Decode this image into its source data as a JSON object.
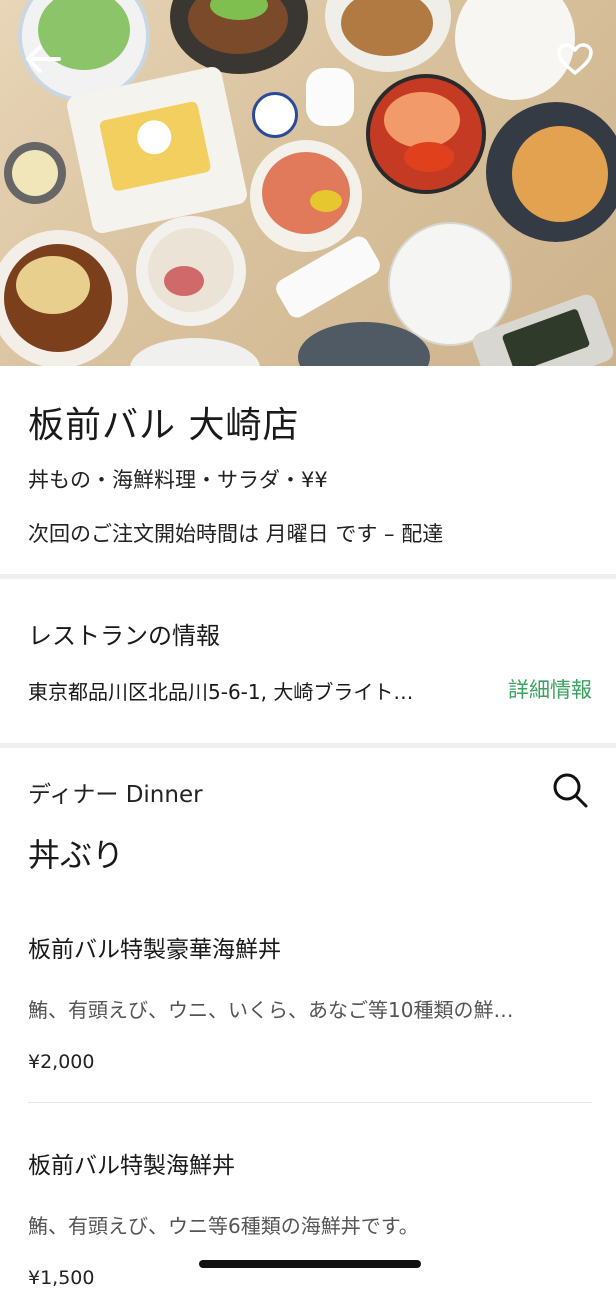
{
  "restaurant": {
    "name": "板前バル 大崎店",
    "categories": "丼もの・海鮮料理・サラダ・¥¥",
    "next_order_time": "次回のご注文開始時間は 月曜日 です – 配達"
  },
  "restaurant_info": {
    "heading": "レストランの情報",
    "address": "東京都品川区北品川5-6-1, 大崎ブライト…",
    "details_link": "詳細情報"
  },
  "menu": {
    "name": "ディナー Dinner",
    "section_title": "丼ぶり",
    "items": [
      {
        "name": "板前バル特製豪華海鮮丼",
        "description": "鮪、有頭えび、ウニ、いくら、あなご等10種類の鮮…",
        "price": "¥2,000"
      },
      {
        "name": "板前バル特製海鮮丼",
        "description": "鮪、有頭えび、ウニ等6種類の海鮮丼です。",
        "price": "¥1,500"
      }
    ]
  },
  "icons": {
    "back": "back-arrow-icon",
    "favorite": "heart-icon",
    "search": "search-icon"
  },
  "colors": {
    "accent_green": "#3aa35f",
    "divider": "#eeeeee"
  }
}
